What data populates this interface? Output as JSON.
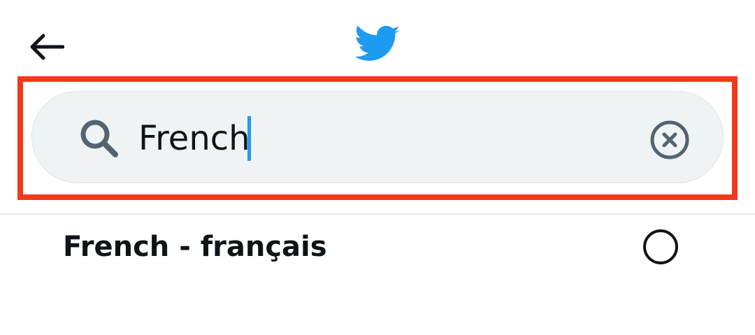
{
  "header": {
    "back_icon": "arrow-left-icon",
    "logo_icon": "twitter-bird-icon",
    "brand_color": "#1d9bf0"
  },
  "search": {
    "value": "French",
    "search_icon": "search-icon",
    "clear_icon": "clear-circle-x-icon",
    "highlight_color": "#f23a1a"
  },
  "results": [
    {
      "label": "French - français",
      "selected": false
    }
  ]
}
